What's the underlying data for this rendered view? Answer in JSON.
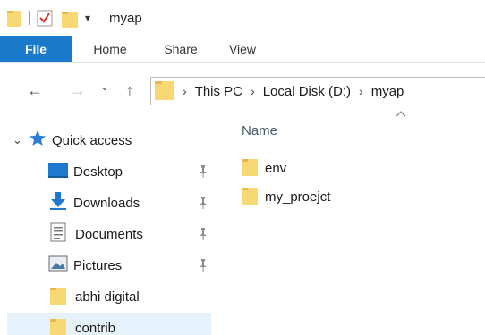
{
  "window": {
    "title": "myap",
    "qat_dropdown_glyph": "▾"
  },
  "ribbon": {
    "tabs": [
      {
        "label": "File",
        "active": true
      },
      {
        "label": "Home"
      },
      {
        "label": "Share"
      },
      {
        "label": "View"
      }
    ]
  },
  "navigation": {
    "back_glyph": "←",
    "forward_glyph": "→",
    "recent_glyph": "⌄",
    "up_glyph": "↑"
  },
  "address": {
    "separator": "›",
    "breadcrumbs": [
      "This PC",
      "Local Disk (D:)",
      "myap"
    ]
  },
  "nav_pane": {
    "quick_access": {
      "label": "Quick access",
      "expanded": true,
      "expand_glyph": "⌄"
    },
    "items": [
      {
        "label": "Desktop",
        "icon": "desktop-icon",
        "pinned": true
      },
      {
        "label": "Downloads",
        "icon": "downloads-icon",
        "pinned": true
      },
      {
        "label": "Documents",
        "icon": "documents-icon",
        "pinned": true
      },
      {
        "label": "Pictures",
        "icon": "pictures-icon",
        "pinned": true
      },
      {
        "label": "abhi digital",
        "icon": "folder-icon",
        "pinned": false
      },
      {
        "label": "contrib",
        "icon": "folder-icon",
        "pinned": false,
        "selected": true
      }
    ]
  },
  "content": {
    "columns": [
      "Name"
    ],
    "sort_direction": "ascending",
    "files": [
      {
        "name": "env",
        "type": "folder"
      },
      {
        "name": "my_proejct",
        "type": "folder"
      }
    ]
  },
  "colors": {
    "file_tab": "#1979ca",
    "folder": "#f8d775",
    "folder_dark": "#e8b84a",
    "selection": "#e5f1fb",
    "star": "#2b7cd3"
  }
}
